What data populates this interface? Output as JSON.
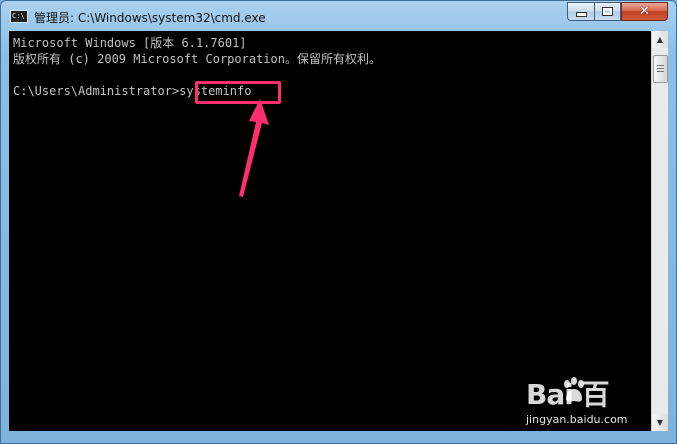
{
  "window": {
    "title": "管理员: C:\\Windows\\system32\\cmd.exe",
    "icon": "cmd-icon",
    "icon_text": "C:\\"
  },
  "caption_buttons": {
    "minimize": "minimize-icon",
    "maximize": "maximize-icon",
    "close_label": "✕"
  },
  "console": {
    "lines": [
      "Microsoft Windows [版本 6.1.7601]",
      "版权所有 (c) 2009 Microsoft Corporation。保留所有权利。",
      "",
      "C:\\Users\\Administrator>systeminfo"
    ],
    "highlight_color": "#ff2e6e"
  },
  "scrollbar": {
    "up_arrow": "▲",
    "down_arrow": "▼"
  },
  "watermark": {
    "logo_text": "Bai  百",
    "url": "jingyan.baidu.com"
  }
}
